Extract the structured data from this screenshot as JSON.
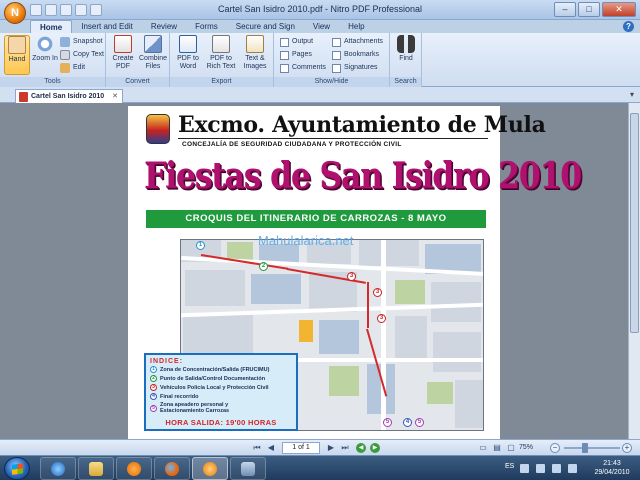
{
  "window": {
    "title": "Cartel San Isidro 2010.pdf - Nitro PDF Professional",
    "app_badge": "N"
  },
  "ribbon_tabs": [
    "Home",
    "Insert and Edit",
    "Review",
    "Forms",
    "Secure and Sign",
    "View",
    "Help"
  ],
  "ribbon": {
    "tools": {
      "label": "Tools",
      "hand": "Hand",
      "zoom_in": "Zoom In",
      "snapshot": "Snapshot",
      "copy_text": "Copy Text",
      "edit": "Edit"
    },
    "convert": {
      "label": "Convert",
      "create_pdf": "Create PDF",
      "combine_files": "Combine Files"
    },
    "export": {
      "label": "Export",
      "pdf_to_word": "PDF to Word",
      "pdf_to_rich_text": "PDF to Rich Text",
      "text_images": "Text & Images"
    },
    "show_hide": {
      "label": "Show/Hide",
      "output": "Output",
      "pages": "Pages",
      "comments": "Comments",
      "attachments": "Attachments",
      "bookmarks": "Bookmarks",
      "signatures": "Signatures"
    },
    "search": {
      "label": "Search",
      "find": "Find"
    }
  },
  "document_tab": "Cartel San Isidro 2010",
  "poster": {
    "header": "Excmo. Ayuntamiento de Mula",
    "subheader": "CONCEJALÍA DE SEGURIDAD CIUDADANA Y PROTECCIÓN CIVIL",
    "title": "Fiestas de San Isidro 2010",
    "banner": "CROQUIS DEL ITINERARIO DE CARROZAS - 8 MAYO",
    "watermark": "Mahulalarica.net",
    "legend_title": "INDICE:",
    "legend": [
      {
        "n": "1",
        "text": "Zona de Concentración/Salida (FRUCIMU)"
      },
      {
        "n": "2",
        "text": "Punto de Salida/Control Documentación"
      },
      {
        "n": "3",
        "text": "Vehículos Policía Local y Protección Civil"
      },
      {
        "n": "4",
        "text": "Final recorrido"
      },
      {
        "n": "5",
        "text": "Zona apeadero personal y Estacionamiento Carrozas"
      }
    ],
    "hora_salida": "HORA SALIDA: 19'00 HORAS"
  },
  "nav": {
    "page_indicator": "1 of 1",
    "zoom": "75%"
  },
  "taskbar": {
    "language": "ES",
    "time": "21:43",
    "date": "29/04/2010"
  },
  "colors": {
    "title_magenta": "#b0106e",
    "banner_green": "#1f9a3d",
    "route_red": "#d52a2a",
    "legend_blue": "#1a6dbf"
  }
}
